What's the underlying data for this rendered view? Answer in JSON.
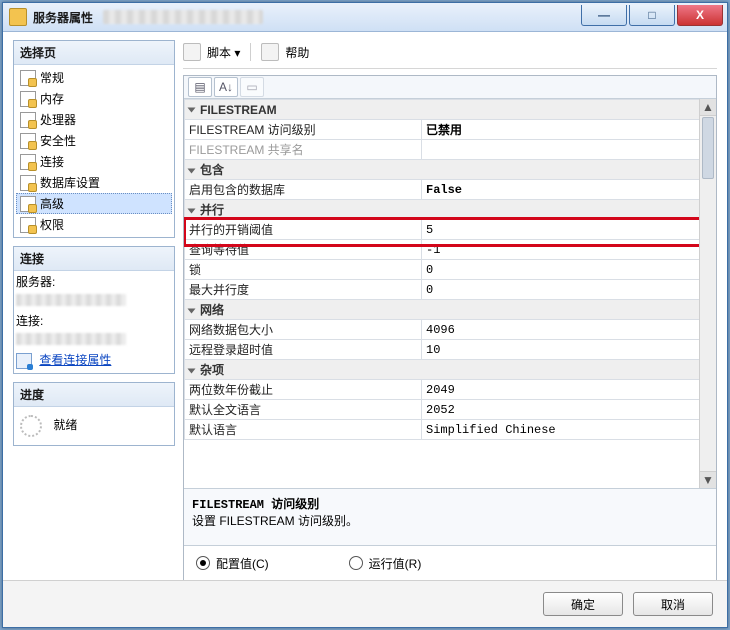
{
  "window": {
    "title": "服务器属性"
  },
  "toolbar": {
    "script": "脚本",
    "help": "帮助"
  },
  "left": {
    "select_page": "选择页",
    "pages": [
      "常规",
      "内存",
      "处理器",
      "安全性",
      "连接",
      "数据库设置",
      "高级",
      "权限"
    ],
    "selected_index": 6,
    "connection_header": "连接",
    "server_label": "服务器:",
    "conn_label": "连接:",
    "view_props": "查看连接属性",
    "progress_header": "进度",
    "ready": "就绪"
  },
  "grid": {
    "groups": [
      {
        "name": "FILESTREAM",
        "rows": [
          {
            "key": "FILESTREAM 访问级别",
            "val": "已禁用",
            "bold": true
          },
          {
            "key": "FILESTREAM 共享名",
            "val": "",
            "disabled": true
          }
        ]
      },
      {
        "name": "包含",
        "rows": [
          {
            "key": "启用包含的数据库",
            "val": "False",
            "bold": true
          }
        ]
      },
      {
        "name": "并行",
        "rows": [
          {
            "key": "并行的开销阈值",
            "val": "5",
            "highlight": true
          },
          {
            "key": "查询等待值",
            "val": "-1"
          },
          {
            "key": "锁",
            "val": "0"
          },
          {
            "key": "最大并行度",
            "val": "0"
          }
        ]
      },
      {
        "name": "网络",
        "rows": [
          {
            "key": "网络数据包大小",
            "val": "4096"
          },
          {
            "key": "远程登录超时值",
            "val": "10"
          }
        ]
      },
      {
        "name": "杂项",
        "rows": [
          {
            "key": "两位数年份截止",
            "val": "2049"
          },
          {
            "key": "默认全文语言",
            "val": "2052"
          },
          {
            "key": "默认语言",
            "val": "Simplified Chinese",
            "cut": true
          }
        ]
      }
    ],
    "desc_title": "FILESTREAM 访问级别",
    "desc_body": "设置 FILESTREAM 访问级别。"
  },
  "radios": {
    "configured": "配置值(C)",
    "running": "运行值(R)",
    "selected": 0
  },
  "footer": {
    "ok": "确定",
    "cancel": "取消"
  }
}
